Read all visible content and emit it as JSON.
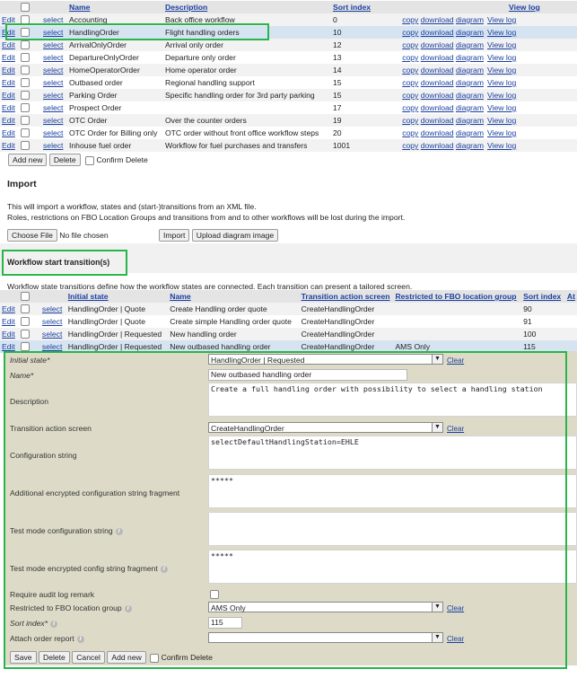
{
  "workflows": {
    "headers": {
      "name": "Name",
      "description": "Description",
      "sort": "Sort index",
      "viewlog": "View log"
    },
    "link_labels": {
      "edit": "Edit",
      "select": "select",
      "copy": "copy",
      "download": "download",
      "diagram": "diagram",
      "viewlog": "View log"
    },
    "rows": [
      {
        "name": "Accounting",
        "description": "Back office workflow",
        "sort": "0"
      },
      {
        "name": "HandlingOrder",
        "description": "Flight handling orders",
        "sort": "10"
      },
      {
        "name": "ArrivalOnlyOrder",
        "description": "Arrival only order",
        "sort": "12"
      },
      {
        "name": "DepartureOnlyOrder",
        "description": "Departure only order",
        "sort": "13"
      },
      {
        "name": "HomeOperatorOrder",
        "description": "Home operator order",
        "sort": "14"
      },
      {
        "name": "Outbased order",
        "description": "Regional handling support",
        "sort": "15"
      },
      {
        "name": "Parking Order",
        "description": "Specific handling order for 3rd party parking",
        "sort": "15"
      },
      {
        "name": "Prospect Order",
        "description": "",
        "sort": "17"
      },
      {
        "name": "OTC Order",
        "description": "Over the counter orders",
        "sort": "19"
      },
      {
        "name": "OTC Order for Billing only",
        "description": "OTC order without front office workflow steps",
        "sort": "20"
      },
      {
        "name": "Inhouse fuel order",
        "description": "Workflow for fuel purchases and transfers",
        "sort": "1001"
      }
    ],
    "add_new": "Add new",
    "delete": "Delete",
    "confirm_delete": "Confirm Delete"
  },
  "import": {
    "title": "Import",
    "line1": "This will import a workflow, states and (start-)transitions from an XML file.",
    "line2": "Roles, restrictions on FBO Location Groups and transitions from and to other workflows will be lost during the import.",
    "choose_file": "Choose File",
    "no_file": "No file chosen",
    "import_btn": "Import",
    "upload_btn": "Upload diagram image"
  },
  "transitions": {
    "title": "Workflow start transition(s)",
    "description": "Workflow state transitions define how the workflow states are connected. Each transition can present a tailored screen.",
    "headers": {
      "initial": "Initial state",
      "name": "Name",
      "screen": "Transition action screen",
      "restricted": "Restricted to FBO location group",
      "sort": "Sort index",
      "at": "At"
    },
    "rows": [
      {
        "initial": "HandlingOrder | Quote",
        "name": "Create Handling order quote",
        "screen": "CreateHandlingOrder",
        "restricted": "",
        "sort": "90"
      },
      {
        "initial": "HandlingOrder | Quote",
        "name": "Create simple Handling order quote",
        "screen": "CreateHandlingOrder",
        "restricted": "",
        "sort": "91"
      },
      {
        "initial": "HandlingOrder | Requested",
        "name": "New handling order",
        "screen": "CreateHandlingOrder",
        "restricted": "",
        "sort": "100"
      },
      {
        "initial": "HandlingOrder | Requested",
        "name": "New outbased handling order",
        "screen": "CreateHandlingOrder",
        "restricted": "AMS Only",
        "sort": "115"
      }
    ]
  },
  "form": {
    "labels": {
      "initial_state": "Initial state*",
      "name": "Name*",
      "description": "Description",
      "screen": "Transition action screen",
      "config": "Configuration string",
      "enc_config": "Additional encrypted configuration string fragment",
      "test_config": "Test mode configuration string",
      "test_enc": "Test mode encrypted config string fragment",
      "audit": "Require audit log remark",
      "restricted": "Restricted to FBO location group",
      "sort": "Sort index*",
      "attach": "Attach order report"
    },
    "values": {
      "initial_state": "HandlingOrder | Requested",
      "name": "New outbased handling order",
      "description": "Create a full handling order with possibility to select a handling station",
      "screen": "CreateHandlingOrder",
      "config": "selectDefaultHandlingStation=EHLE",
      "enc_config": "*****",
      "test_config": "",
      "test_enc": "*****",
      "restricted": "AMS Only",
      "sort": "115",
      "attach": ""
    },
    "clear": "Clear",
    "info_glyph": "i",
    "buttons": {
      "save": "Save",
      "delete": "Delete",
      "cancel": "Cancel",
      "add_new": "Add new",
      "confirm_delete": "Confirm Delete"
    }
  }
}
